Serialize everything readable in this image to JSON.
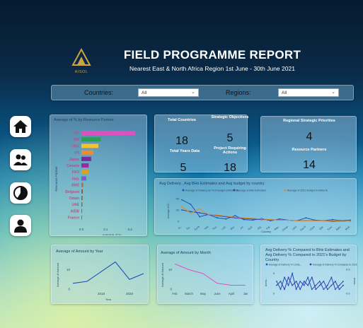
{
  "header": {
    "logo_text": "AISOL",
    "title": "FIELD PROGRAMME REPORT",
    "subtitle": "Nearest East & North Africa Region 1st June - 30th June 2021"
  },
  "filters": {
    "countries_label": "Countries:",
    "countries_value": "All",
    "regions_label": "Regions:",
    "regions_value": "All"
  },
  "nav": [
    {
      "icon": "home-icon"
    },
    {
      "icon": "people-icon"
    },
    {
      "icon": "pie-chart-icon"
    },
    {
      "icon": "user-icon"
    }
  ],
  "kpis": {
    "total_countries_label": "Total Countries",
    "total_countries": "18",
    "strategic_objectives_label": "Strategic Objectives",
    "strategic_objectives": "5",
    "total_years_label": "Total Years Data",
    "total_years": "5",
    "project_actions_label": "Project Requiring Actions",
    "project_actions": "18",
    "regional_priorities_label": "Regional Strategic Priorities",
    "regional_priorities": "4",
    "resource_partners_label": "Resource Partners",
    "resource_partners": "14"
  },
  "chart_data": [
    {
      "id": "resource-partner",
      "type": "bar",
      "title": "Average of % by Resource Partner",
      "xlabel": "Average of %",
      "ylabel": "Resource Partner",
      "categories": [
        "EC",
        "WB",
        "USA",
        "UN",
        "Japan",
        "Canada",
        "FAO",
        "Italy",
        "BMZ",
        "Belgium",
        "Oman",
        "UAE",
        "AfDB",
        "France"
      ],
      "values": [
        0.22,
        0.08,
        0.07,
        0.05,
        0.04,
        0.03,
        0.03,
        0.02,
        0.008,
        0.006,
        0.005,
        0.004,
        0.003,
        0.002
      ],
      "colors": [
        "#e04fc0",
        "#2aa150",
        "#f2c232",
        "#f08a30",
        "#7a2a9a",
        "#9a2aa8",
        "#e0a020",
        "#7a60c0",
        "#c07030",
        "#8a6040",
        "#a0602a",
        "#9a5a30",
        "#a06040",
        "#8a7070"
      ],
      "xticks": [
        "0.0",
        "0.1",
        "0.2"
      ],
      "xlim": [
        0,
        0.25
      ]
    },
    {
      "id": "delivery-by-country",
      "type": "line",
      "title": "Avg Delivery , Avg BHs Estimates and Avg budget by country",
      "legend": [
        "Average of Delivery as % of budget (millions $)",
        "Average of BHs Estimates",
        "Average of 2021 Budget in million $"
      ],
      "colors": [
        "#1f4fb8",
        "#3a3aa8",
        "#e08a2a"
      ],
      "categories": [
        "Ye..",
        "Eg..",
        "Syria",
        "Iraq",
        "Tun.",
        "Leb.",
        "Mor.",
        "Jor.",
        "Sud.",
        "Alg.",
        "Pal.",
        "Mau.",
        "Oman",
        "UAE",
        "Saudi",
        "Libya",
        "Qat.",
        "Kuw.",
        "Bahr.",
        "Mult."
      ],
      "series": [
        {
          "name": "Average of Delivery as % of budget (millions $)",
          "values": [
            38,
            30,
            8,
            12,
            6,
            4,
            10,
            3,
            2,
            5,
            1,
            4,
            2,
            1,
            6,
            2,
            1,
            3,
            1,
            2
          ]
        },
        {
          "name": "Average of BHs Estimates",
          "values": [
            20,
            17,
            15,
            12,
            10,
            8,
            6,
            5,
            4,
            3,
            3,
            2,
            2,
            1,
            1,
            1,
            1,
            0,
            0,
            0
          ]
        },
        {
          "name": "Average of 2021 Budget in million $",
          "values": [
            26,
            14,
            22,
            12,
            11,
            9,
            7,
            6,
            5,
            4,
            3,
            2,
            2,
            1,
            1,
            1,
            1,
            1,
            0,
            0
          ]
        }
      ],
      "ylabel": "Average of D...",
      "xlabel": "Country",
      "yticks": [
        "0",
        "20",
        "40"
      ],
      "ylim": [
        0,
        45
      ]
    },
    {
      "id": "amount-by-year",
      "type": "line",
      "title": "Average of Amount by Year",
      "ylabel": "Average of Amount",
      "xlabel": "Year",
      "x": [
        2016,
        2017,
        2018,
        2019,
        2020,
        2021
      ],
      "values": [
        3,
        4,
        9,
        14,
        5,
        8
      ],
      "xticks": [
        "2018",
        "2020"
      ],
      "yticks": [
        "0",
        "10"
      ],
      "ylim": [
        0,
        16
      ],
      "color": "#1f4fb8"
    },
    {
      "id": "amount-by-month",
      "type": "line",
      "title": "Average of Amount by Month",
      "ylabel": "Average of Amount",
      "categories": [
        "Feb",
        "March",
        "May",
        "June",
        "April",
        "Jan"
      ],
      "values": [
        13,
        10,
        8,
        3,
        2,
        2
      ],
      "yticks": [
        "0",
        "10"
      ],
      "ylim": [
        0,
        16
      ],
      "color": "#e04fc0"
    },
    {
      "id": "compared-by-country",
      "type": "line",
      "title": "Avg Delivery % Compared to BHs Estimates and Avg Delivery % Compared to 2021's Budget by Country",
      "legend": [
        "Average of Delivery % Comp...",
        "Average of Delivery % Compared to 2021's Bud..."
      ],
      "colors": [
        "#1f4fb8",
        "#3a3aa8"
      ],
      "categories": [
        "1",
        "2",
        "3",
        "4",
        "5",
        "6",
        "7",
        "8",
        "9",
        "10",
        "11",
        "12",
        "13",
        "14",
        "15",
        "16",
        "17",
        "18"
      ],
      "series": [
        {
          "name": "Average of Delivery % Comp...",
          "values": [
            3,
            1,
            4,
            2,
            5,
            1,
            3,
            2,
            4,
            1,
            2,
            3,
            1,
            2,
            4,
            1,
            2,
            3
          ]
        },
        {
          "name": "Average of Delivery % Compared to 2021's Bud...",
          "values": [
            2,
            3,
            1,
            4,
            2,
            3,
            1,
            3,
            2,
            4,
            1,
            2,
            3,
            1,
            2,
            3,
            1,
            2
          ]
        }
      ],
      "ylabel_left": "Avera...",
      "ylabel_right": "Avera...",
      "yticks_left": [
        "0",
        "5"
      ],
      "yticks_right": [
        "0.0",
        "0.5"
      ],
      "ylim": [
        0,
        6
      ]
    }
  ]
}
